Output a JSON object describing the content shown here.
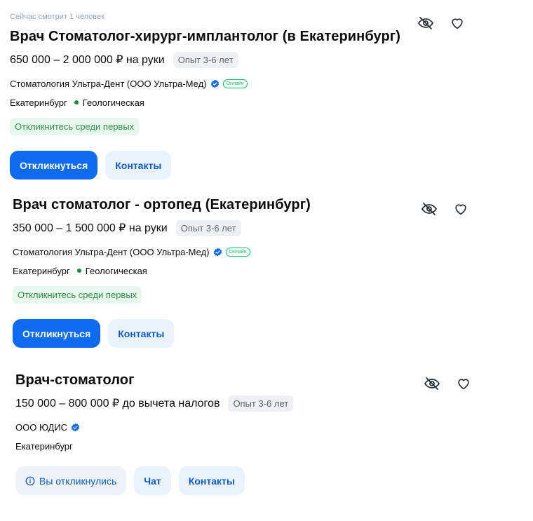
{
  "cards": [
    {
      "watchers": "Сейчас смотрит 1 человек",
      "title": "Врач Стоматолог-хирург-имплантолог (в Екатеринбург)",
      "salary": "650 000 – 2 000 000 ₽ на руки",
      "experience": "Опыт 3-6 лет",
      "company": "Стоматология Ультра-Дент (ООО Ультра-Мед)",
      "online": "Онлайн",
      "city": "Екатеринбург",
      "metro": "Геологическая",
      "promo": "Откликнитесь среди первых",
      "apply_label": "Откликнуться",
      "contacts_label": "Контакты"
    },
    {
      "title": "Врач стоматолог - ортопед (Екатеринбург)",
      "salary": "350 000 – 1 500 000 ₽ на руки",
      "experience": "Опыт 3-6 лет",
      "company": "Стоматология Ультра-Дент (ООО Ультра-Мед)",
      "online": "Онлайн",
      "city": "Екатеринбург",
      "metro": "Геологическая",
      "promo": "Откликнитесь среди первых",
      "apply_label": "Откликнуться",
      "contacts_label": "Контакты"
    },
    {
      "title": "Врач-стоматолог",
      "salary": "150 000 – 800 000 ₽ до вычета налогов",
      "experience": "Опыт 3-6 лет",
      "company": "ООО ЮДИС",
      "city": "Екатеринбург",
      "responded_label": "Вы откликнулись",
      "chat_label": "Чат",
      "contacts_label": "Контакты"
    }
  ],
  "icons": {
    "hide": "eye-off-icon",
    "favorite": "heart-icon",
    "verified": "verified-check-icon",
    "info": "info-icon"
  },
  "colors": {
    "primary": "#0d6bef",
    "secondary_bg": "#eaf2fc",
    "promo_bg": "#e8f7ec",
    "promo_text": "#2f8f4e",
    "online": "#0dc267",
    "metro": "#1b8a3a"
  }
}
